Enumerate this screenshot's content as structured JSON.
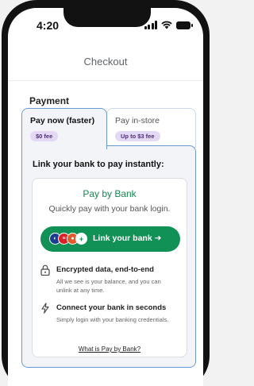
{
  "status_bar": {
    "time": "4:20"
  },
  "header": {
    "title": "Checkout"
  },
  "payment": {
    "section_title": "Payment",
    "tabs": [
      {
        "label": "Pay now (faster)",
        "badge": "$0 fee",
        "selected": true
      },
      {
        "label": "Pay in-store",
        "badge": "Up to $3 fee",
        "selected": false
      }
    ]
  },
  "panel": {
    "heading": "Link your bank to pay instantly:",
    "card": {
      "title": "Pay by Bank",
      "subtitle": "Quickly pay with your bank login.",
      "button_label": "Link your bank ➜",
      "features": [
        {
          "icon": "lock-icon",
          "title": "Encrypted data, end-to-end",
          "body": "All we see is your balance, and you can unlink at any time."
        },
        {
          "icon": "lightning-icon",
          "title": "Connect your bank in seconds",
          "body": "Simply login with your banking credentials."
        }
      ],
      "link": "What is Pay by Bank?"
    }
  },
  "colors": {
    "accent_green": "#119155",
    "tab_border_active": "#6a9ad6",
    "badge_bg": "#e4d9f4"
  }
}
